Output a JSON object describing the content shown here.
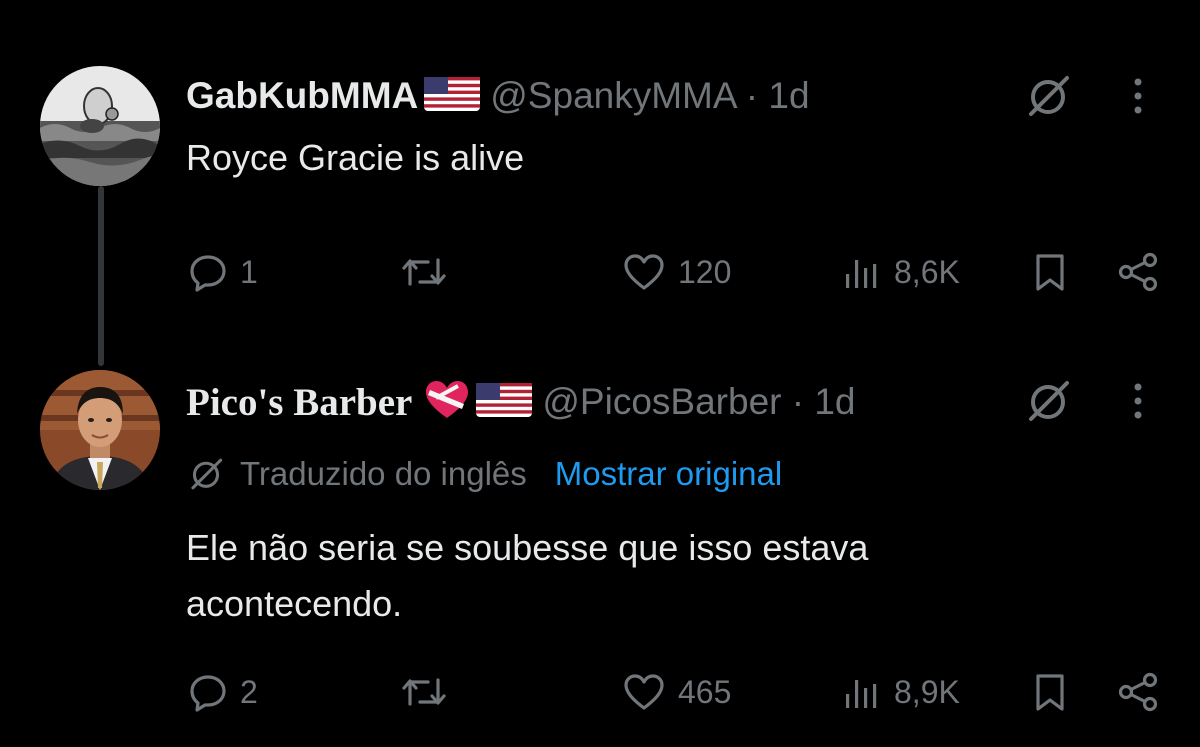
{
  "tweets": [
    {
      "name": "GabKubMMA",
      "flag": "🇺🇸",
      "handle": "@SpankyMMA · 1d",
      "text": "Royce Gracie is alive",
      "replies": "1",
      "reposts": "",
      "likes": "120",
      "views": "8,6K"
    },
    {
      "name": "Pico's Barber",
      "emojis": [
        "❤️‍🩹",
        "🇺🇸"
      ],
      "handle": "@PicosBarber · 1d",
      "translated_label": "Traduzido do inglês",
      "show_original": "Mostrar original",
      "text_line1": "Ele não seria se soubesse que isso estava",
      "text_line2": "acontecendo.",
      "replies": "2",
      "reposts": "",
      "likes": "465",
      "views": "8,9K"
    }
  ],
  "colors": {
    "background": "#000000",
    "text": "#e7e9ea",
    "muted": "#71767b",
    "link": "#1d9bf0",
    "thread_line": "#333639"
  },
  "icons": [
    "reply-icon",
    "repost-icon",
    "like-icon",
    "views-icon",
    "bookmark-icon",
    "share-icon",
    "grok-icon",
    "more-icon",
    "translate-icon"
  ]
}
